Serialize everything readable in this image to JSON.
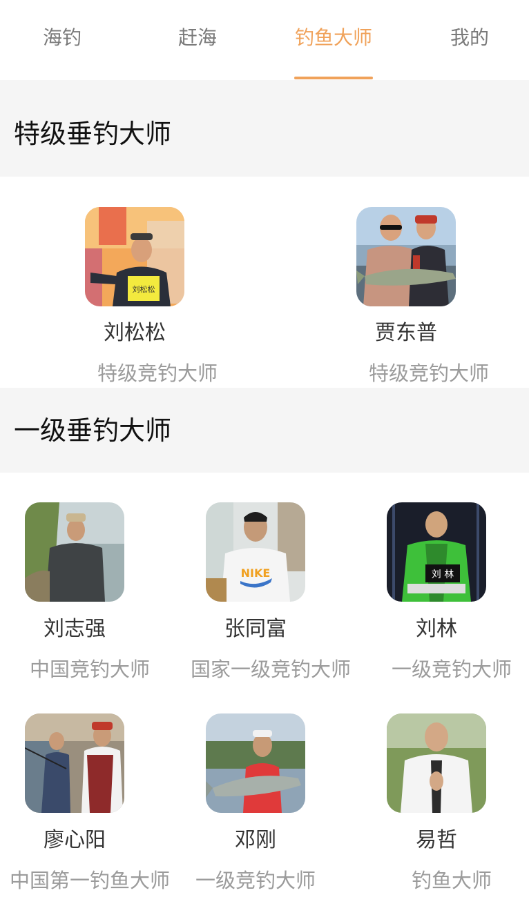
{
  "tabs": [
    {
      "label": "海钓"
    },
    {
      "label": "赶海"
    },
    {
      "label": "钓鱼大师"
    },
    {
      "label": "我的"
    }
  ],
  "active_tab": "钓鱼大师",
  "accent_color": "#f0a25a",
  "sections": [
    {
      "title": "特级垂钓大师",
      "masters": [
        {
          "name": "刘松松",
          "rank": "特级竞钓大师",
          "photo": "angler-at-event-photo",
          "badge_text": "刘松松"
        },
        {
          "name": "贾东普",
          "rank": "特级竞钓大师",
          "photo": "two-anglers-with-carp-photo"
        }
      ]
    },
    {
      "title": "一级垂钓大师",
      "masters": [
        {
          "name": "刘志强",
          "rank": "中国竞钓大师",
          "photo": "angler-by-lake-photo"
        },
        {
          "name": "张同富",
          "rank": "国家一级竞钓大师",
          "photo": "man-in-white-tshirt-photo"
        },
        {
          "name": "刘林",
          "rank": "一级竞钓大师",
          "photo": "man-in-green-jacket-photo",
          "badge_text": "刘 林"
        },
        {
          "name": "廖心阳",
          "rank": "中国第一钓鱼大师",
          "photo": "angler-fishing-crowd-photo"
        },
        {
          "name": "邓刚",
          "rank": "一级竞钓大师",
          "photo": "man-holding-fish-photo"
        },
        {
          "name": "易哲",
          "rank": "钓鱼大师",
          "photo": "man-in-white-suit-photo"
        }
      ]
    }
  ]
}
